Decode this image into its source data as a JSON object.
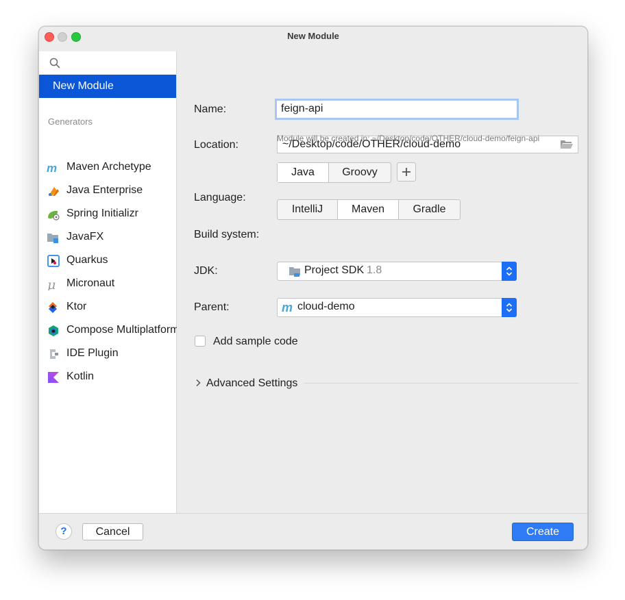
{
  "window": {
    "title": "New Module"
  },
  "sidebar": {
    "selected_item": "New Module",
    "generators_header": "Generators",
    "generators": [
      {
        "label": "Maven Archetype",
        "icon": "maven-icon"
      },
      {
        "label": "Java Enterprise",
        "icon": "java-enterprise-icon"
      },
      {
        "label": "Spring Initializr",
        "icon": "spring-icon"
      },
      {
        "label": "JavaFX",
        "icon": "javafx-icon"
      },
      {
        "label": "Quarkus",
        "icon": "quarkus-icon"
      },
      {
        "label": "Micronaut",
        "icon": "micronaut-icon"
      },
      {
        "label": "Ktor",
        "icon": "ktor-icon"
      },
      {
        "label": "Compose Multiplatform",
        "icon": "compose-icon"
      },
      {
        "label": "IDE Plugin",
        "icon": "ide-plugin-icon"
      },
      {
        "label": "Kotlin",
        "icon": "kotlin-icon"
      }
    ]
  },
  "form": {
    "name_label": "Name:",
    "name_value": "feign-api",
    "location_label": "Location:",
    "location_value": "~/Desktop/code/OTHER/cloud-demo",
    "location_hint": "Module will be created in: ~/Desktop/code/OTHER/cloud-demo/feign-api",
    "language_label": "Language:",
    "languages": [
      "Java",
      "Groovy"
    ],
    "language_selected": "Java",
    "build_label": "Build system:",
    "build_systems": [
      "IntelliJ",
      "Maven",
      "Gradle"
    ],
    "build_selected": "Maven",
    "jdk_label": "JDK:",
    "jdk_value": "Project SDK",
    "jdk_version": "1.8",
    "parent_label": "Parent:",
    "parent_value": "cloud-demo",
    "sample_code_label": "Add sample code",
    "sample_code_checked": false,
    "advanced_label": "Advanced Settings"
  },
  "footer": {
    "help_label": "?",
    "cancel_label": "Cancel",
    "create_label": "Create"
  },
  "colors": {
    "accent": "#0a56d6",
    "primary_button": "#2f7bf5",
    "focus_ring": "#a8c6f1"
  }
}
